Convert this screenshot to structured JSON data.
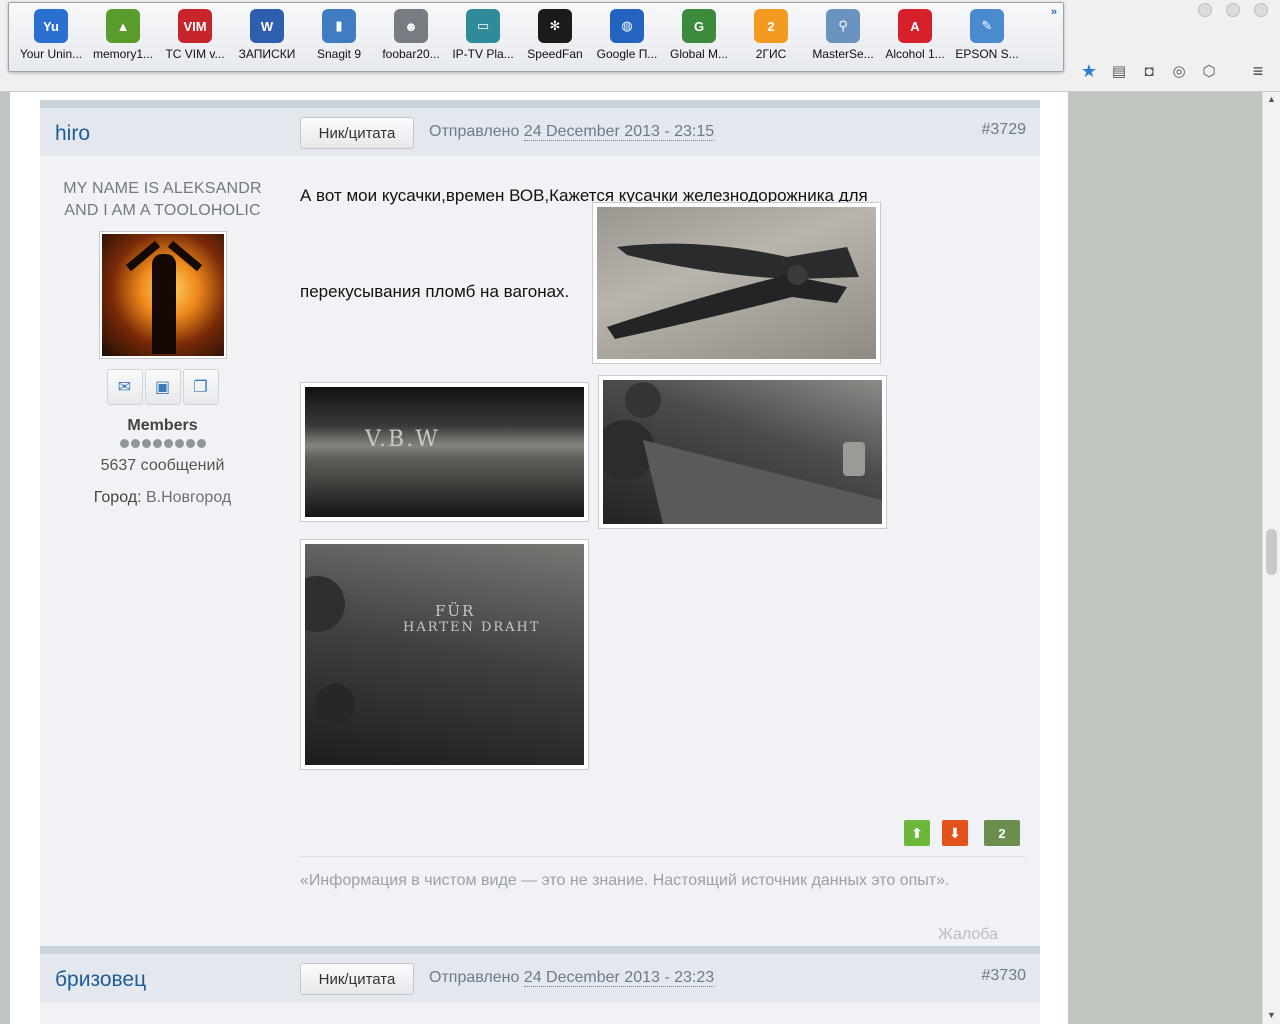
{
  "launcher": {
    "items": [
      {
        "label": "Your Unin...",
        "icon": "uninstaller-icon",
        "color": "#2b6fd1",
        "glyph": "Yu"
      },
      {
        "label": "memory1...",
        "icon": "memory-chart-icon",
        "color": "#5a9b2e",
        "glyph": "▲"
      },
      {
        "label": "TC VIM v...",
        "icon": "vim-icon",
        "color": "#c8242c",
        "glyph": "VIM"
      },
      {
        "label": "ЗАПИСКИ",
        "icon": "word-document-icon",
        "color": "#2e5fae",
        "glyph": "W"
      },
      {
        "label": "Snagit 9",
        "icon": "snagit-icon",
        "color": "#3f7cc2",
        "glyph": "▮"
      },
      {
        "label": "foobar20...",
        "icon": "foobar-alien-icon",
        "color": "#777c82",
        "glyph": "☻"
      },
      {
        "label": "IP-TV Pla...",
        "icon": "tv-player-icon",
        "color": "#2f8a9a",
        "glyph": "▭"
      },
      {
        "label": "SpeedFan",
        "icon": "speedfan-icon",
        "color": "#1b1b1b",
        "glyph": "✻"
      },
      {
        "label": "Google П...",
        "icon": "google-earth-icon",
        "color": "#2463c0",
        "glyph": "◍"
      },
      {
        "label": "Global M...",
        "icon": "global-mapper-icon",
        "color": "#3c8a3c",
        "glyph": "G"
      },
      {
        "label": "2ГИС",
        "icon": "2gis-icon",
        "color": "#f29b20",
        "glyph": "2"
      },
      {
        "label": "MasterSe...",
        "icon": "magnifier-icon",
        "color": "#6b93bf",
        "glyph": "⚲"
      },
      {
        "label": "Alcohol 1...",
        "icon": "alcohol-120-icon",
        "color": "#d8202a",
        "glyph": "A"
      },
      {
        "label": "EPSON S...",
        "icon": "epson-scan-icon",
        "color": "#4a8bd0",
        "glyph": "✎"
      }
    ],
    "more": "»"
  },
  "browser": {
    "icons": [
      "bookmark-star-icon",
      "reading-list-icon",
      "pocket-icon",
      "sync-icon",
      "extension-icon"
    ],
    "menu_glyph": "≡"
  },
  "post1": {
    "author": "hiro",
    "quote_label": "Ник/цитата",
    "sent_prefix": "Отправлено",
    "date": "24 December 2013 - 23:15",
    "number": "#3729",
    "tagline_line1": "MY NAME IS ALEKSANDR",
    "tagline_line2": "AND I AM A TOOLOHOLIC",
    "group": "Members",
    "messages": "5637 сообщений",
    "city_label": "Город:",
    "city_value": "В.Новгород",
    "text_line1": "А вот мои кусачки,времен ВОВ,Кажется кусачки железнодорожника для",
    "text_line2": "перекусывания пломб на вагонах.",
    "engrave1": "V.B.W",
    "engrave3_line1": "FÜR",
    "engrave3_line2": "HARTEN DRAHT",
    "vote_up": "⬆",
    "vote_down": "⬇",
    "vote_count": "2",
    "signature": "«Информация в чистом виде — это не знание. Настоящий источник данных это опыт».",
    "report": "Жалоба"
  },
  "post2": {
    "author": "бризовец",
    "quote_label": "Ник/цитата",
    "sent_prefix": "Отправлено",
    "date": "24 December 2013 - 23:23",
    "number": "#3730"
  }
}
